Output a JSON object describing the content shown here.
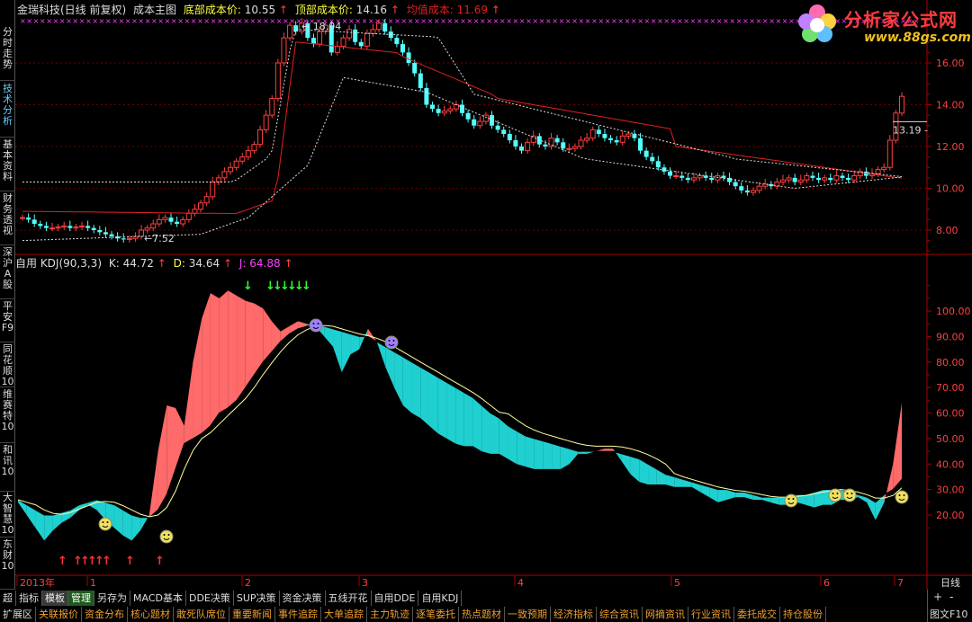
{
  "sidebar": {
    "tabs": [
      {
        "label": "分时走势",
        "top": 0
      },
      {
        "label": "技术分析",
        "top": 0
      },
      {
        "label": "基本资料",
        "top": 0
      },
      {
        "label": "财务透视",
        "top": 0
      },
      {
        "label": "深沪A股",
        "top": 0
      },
      {
        "label": "平安F9",
        "top": 0
      },
      {
        "label": "同花顺10",
        "top": 0
      },
      {
        "label": "维赛特10",
        "top": 0
      },
      {
        "label": "和讯10",
        "top": 0
      },
      {
        "label": "大智慧10",
        "top": 0
      },
      {
        "label": "东财10",
        "top": 0
      }
    ]
  },
  "header": {
    "stock": "金瑞科技(日线 前复权)",
    "indicator": "成本主图",
    "low_cost_label": "底部成本价:",
    "low_cost_value": "10.55",
    "top_cost_label": "顶部成本价:",
    "top_cost_value": "14.16",
    "avg_cost_label": "均值成本:",
    "avg_cost_value": "11.69",
    "arrow": "↑"
  },
  "logo": {
    "name": "分析家公式网",
    "url": "www.88gs.com"
  },
  "price_axis": [
    "16.00",
    "14.00",
    "12.00",
    "10.00",
    "8.00"
  ],
  "price_labels": {
    "high": "18.04",
    "low": "7.52",
    "last": "13.19"
  },
  "kdj": {
    "title": "自用 KDJ(90,3,3)",
    "k_label": "K:",
    "k_value": "44.72",
    "d_label": "D:",
    "d_value": "34.64",
    "j_label": "J:",
    "j_value": "64.88",
    "arrow": "↑"
  },
  "kdj_axis": [
    "100.00",
    "90.00",
    "80.00",
    "70.00",
    "60.00",
    "50.00",
    "40.00",
    "30.00",
    "20.00"
  ],
  "time_axis": [
    "2013年",
    "1",
    "2",
    "3",
    "4",
    "5",
    "6",
    "7"
  ],
  "period": "日线",
  "toolbar_row1": [
    "超",
    "指标",
    "模板",
    "管理",
    "另存为",
    "MACD基本",
    "DDE决策",
    "SUP决策",
    "资金决策",
    "五线开花",
    "自用DDE",
    "自用KDJ"
  ],
  "toolbar_row2": [
    "扩展区",
    "关联报价",
    "资金分布",
    "核心题材",
    "敢死队席位",
    "重要新闻",
    "事件追踪",
    "大单追踪",
    "主力轨迹",
    "逐笔委托",
    "热点题材",
    "一致预期",
    "经济指标",
    "综合资讯",
    "网摘资讯",
    "行业资讯",
    "委托成交",
    "持仓股份"
  ],
  "corner": {
    "plus": "+",
    "minus": "-",
    "f10": "图文F10"
  },
  "colors": {
    "up": "#ff4040",
    "down": "#54ffff",
    "cost_line": "#e02020",
    "kdj_fill_up": "#ff6a6a",
    "kdj_fill_down": "#20d0d0",
    "grid": "#8b0000",
    "text_yellow": "#ffff40",
    "text_purple": "#ff40ff"
  }
}
